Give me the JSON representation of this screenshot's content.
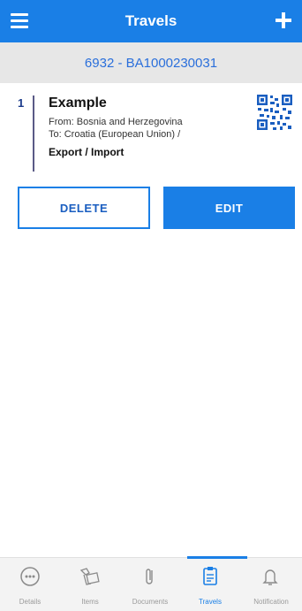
{
  "header": {
    "title": "Travels"
  },
  "subheader": {
    "code": "6932 - BA1000230031"
  },
  "travels": [
    {
      "index": "1",
      "title": "Example",
      "from": "From: Bosnia and Herzegovina",
      "to": "To: Croatia (European Union) /",
      "type": "Export / Import"
    }
  ],
  "actions": {
    "delete_label": "DELETE",
    "edit_label": "EDIT"
  },
  "nav": {
    "items": [
      {
        "label": "Details",
        "icon": "more-horizontal-icon"
      },
      {
        "label": "Items",
        "icon": "box-icon"
      },
      {
        "label": "Documents",
        "icon": "paperclip-icon"
      },
      {
        "label": "Travels",
        "icon": "clipboard-icon"
      },
      {
        "label": "Notification",
        "icon": "bell-icon"
      }
    ],
    "active": "Travels"
  },
  "colors": {
    "primary": "#1a7fe6",
    "subheader_bg": "#e7e7e7",
    "nav_bg": "#f3f3f3"
  }
}
